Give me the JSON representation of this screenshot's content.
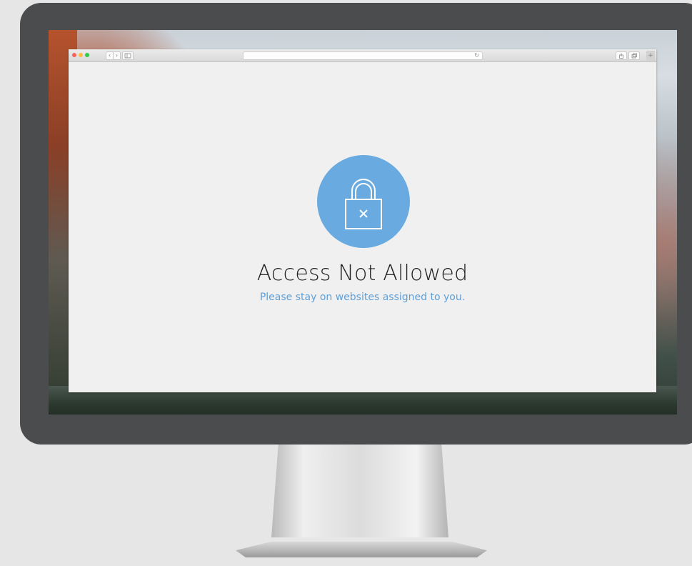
{
  "browser": {
    "toolbar": {
      "back_icon": "chevron-left-icon",
      "forward_icon": "chevron-right-icon",
      "sidebar_icon": "sidebar-icon",
      "reload_icon": "reload-icon",
      "share_icon": "share-icon",
      "tabs_icon": "tabs-icon",
      "new_tab_icon": "plus-icon",
      "back_glyph": "‹",
      "forward_glyph": "›",
      "reload_glyph": "↻",
      "new_tab_glyph": "+"
    },
    "address": {
      "value": ""
    }
  },
  "main": {
    "icon": "lock-x-icon",
    "title": "Access Not Allowed",
    "subtitle": "Please stay on websites assigned to you."
  },
  "colors": {
    "accent": "#69abe0",
    "subtitle": "#5f9fd6",
    "bezel": "#4b4c4e",
    "window_close": "#fc605c",
    "window_minimize": "#fdbc40",
    "window_maximize": "#34c84a"
  }
}
